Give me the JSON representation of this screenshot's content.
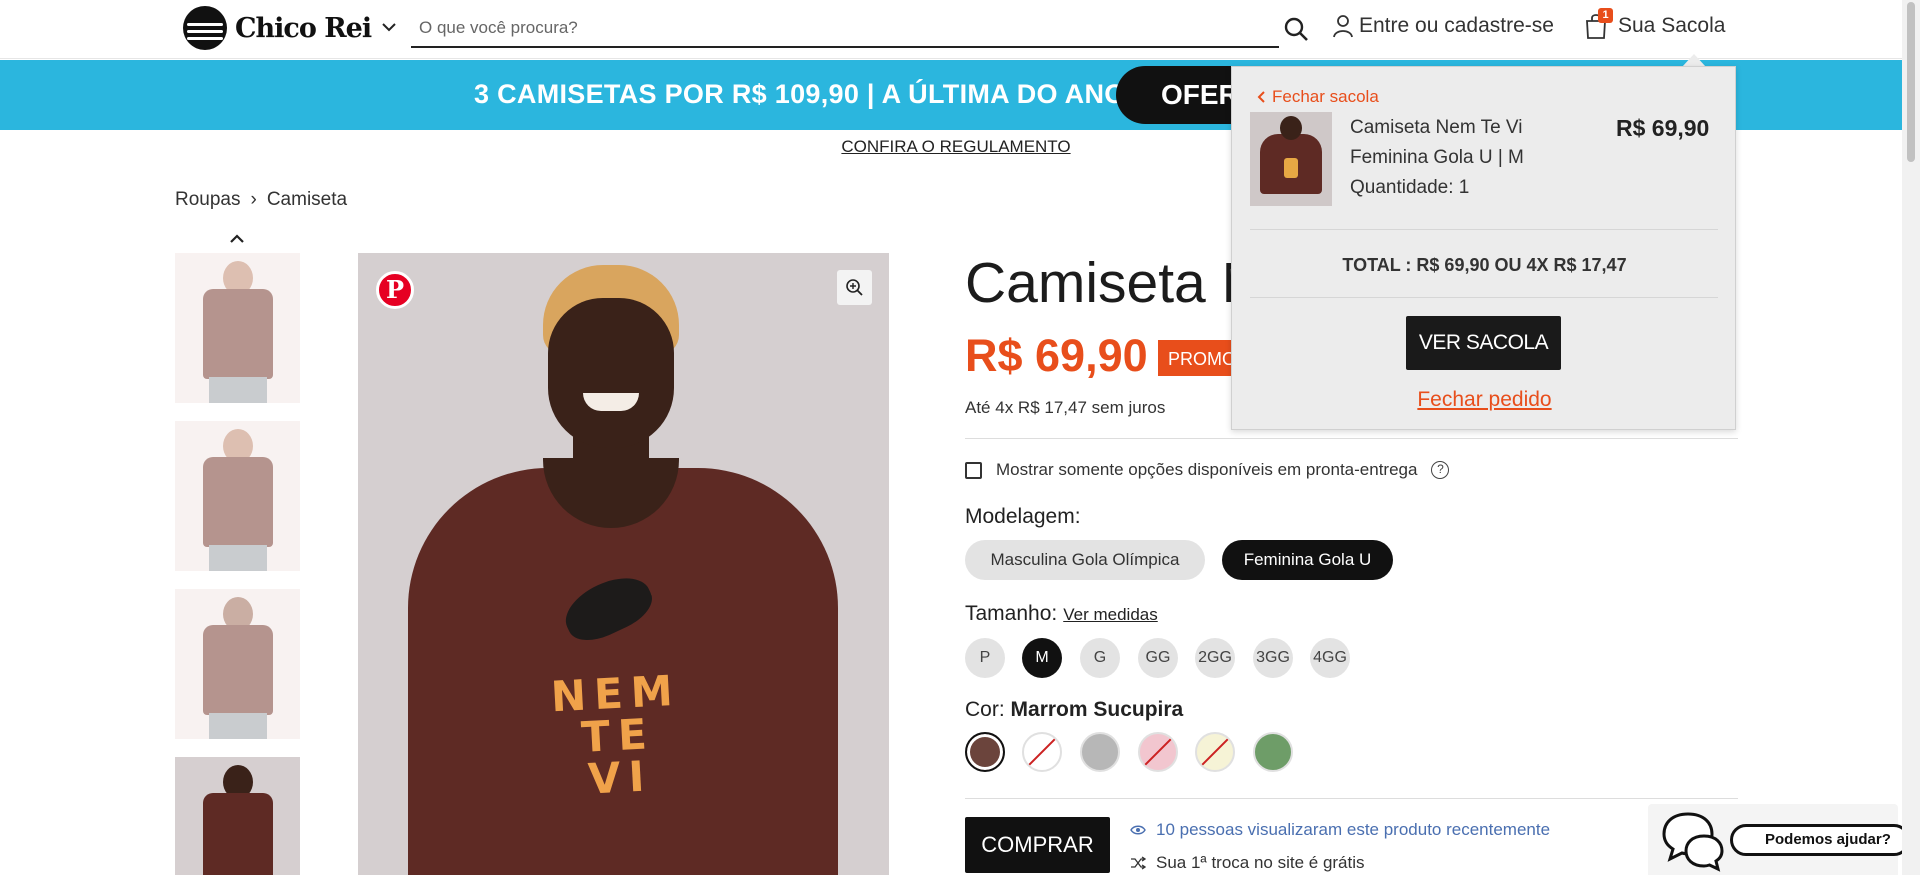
{
  "header": {
    "logo_text": "Chico Rei",
    "search_placeholder": "O que você procura?",
    "account_label": "Entre ou cadastre-se",
    "bag_label": "Sua Sacola",
    "bag_count": "1"
  },
  "banner": {
    "text": "3 CAMISETAS POR R$ 109,90 | A ÚLTIMA DO ANO!",
    "pill_text": "OFERT",
    "rules_link": "CONFIRA O REGULAMENTO"
  },
  "breadcrumb": {
    "items": [
      "Roupas",
      "Camiseta"
    ],
    "separator": "›"
  },
  "product": {
    "title": "Camiseta N",
    "price": "R$ 69,90",
    "promo_tag": "PROMO",
    "installments": "Até 4x R$ 17,47 sem juros",
    "stock_filter_label": "Mostrar somente opções disponíveis em pronta-entrega",
    "print_text": "NEM TE VI",
    "modelagem_label": "Modelagem:",
    "modelagem_options": [
      "Masculina Gola Olímpica",
      "Feminina Gola U"
    ],
    "modelagem_selected": "Feminina Gola U",
    "tamanho_label": "Tamanho:",
    "measures_link": "Ver medidas",
    "sizes": [
      "P",
      "M",
      "G",
      "GG",
      "2GG",
      "3GG",
      "4GG"
    ],
    "size_selected": "M",
    "cor_label": "Cor:",
    "cor_selected": "Marrom Sucupira",
    "colors": [
      {
        "hex": "#6b443c",
        "available": true,
        "selected": true
      },
      {
        "hex": "#ffffff",
        "available": false
      },
      {
        "hex": "#b7b7b7",
        "available": true
      },
      {
        "hex": "#f2c6cf",
        "available": false
      },
      {
        "hex": "#f6f3d6",
        "available": false
      },
      {
        "hex": "#6e9d68",
        "available": true
      }
    ],
    "buy_button": "COMPRAR",
    "viewers_text": "10 pessoas visualizaram este produto recentemente",
    "exchange_text": "Sua 1ª troca no site é grátis"
  },
  "cart_popup": {
    "close_label": "Fechar sacola",
    "item_name_lines": [
      "Camiseta Nem Te Vi",
      "Feminina Gola U | M",
      "Quantidade: 1"
    ],
    "item_price": "R$ 69,90",
    "total_label": "TOTAL : R$ 69,90",
    "total_installments": "OU 4X R$ 17,47",
    "view_bag_button": "VER SACOLA",
    "close_order_link": "Fechar pedido"
  },
  "help_chat": {
    "label": "Podemos ajudar?"
  },
  "colors": {
    "accent": "#e84e1b",
    "banner_blue": "#2bb6de",
    "dark": "#111111"
  }
}
